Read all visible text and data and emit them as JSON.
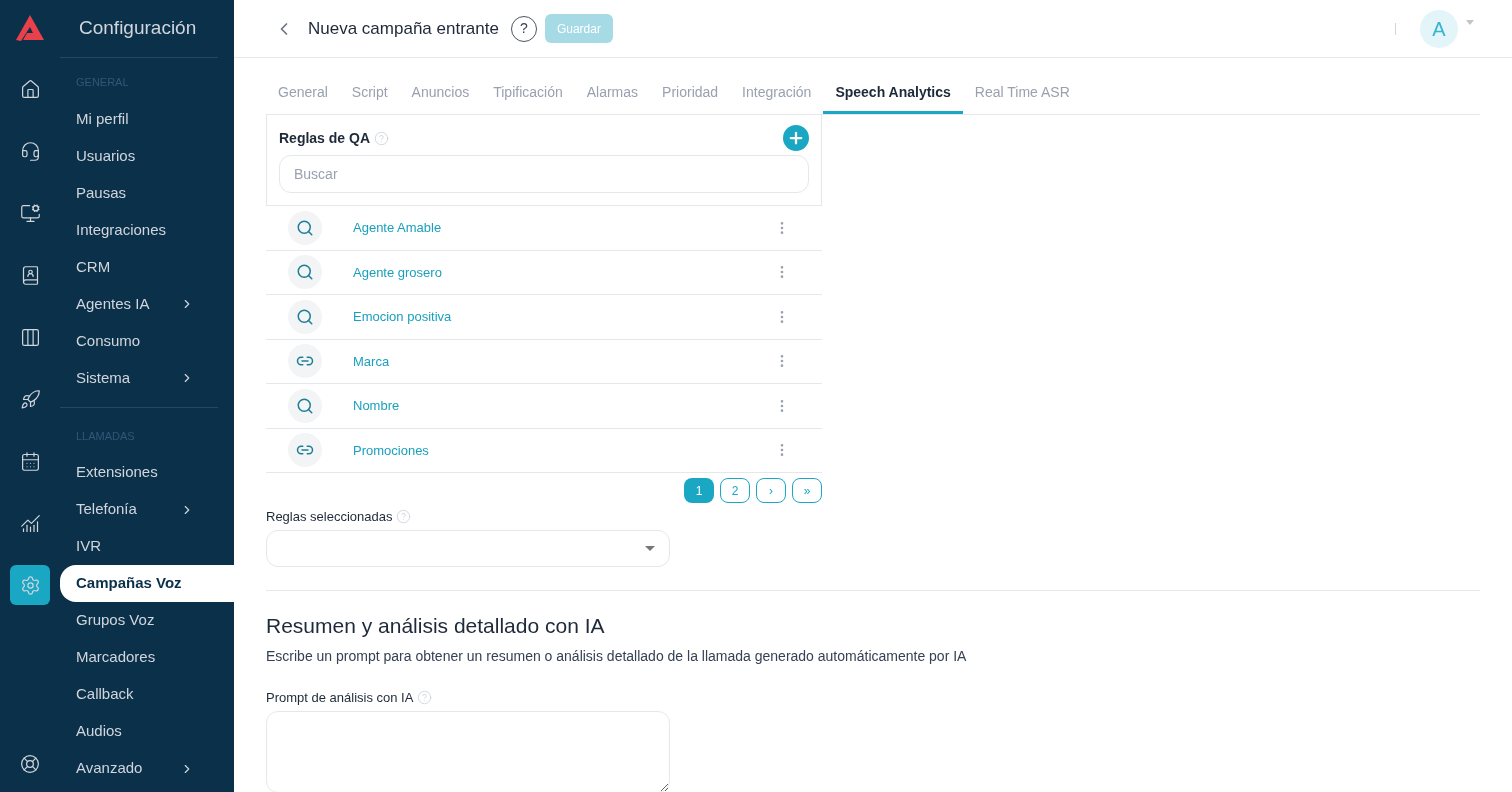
{
  "rail": [
    {
      "kind": "home",
      "selected": false
    },
    {
      "kind": "headset",
      "selected": false
    },
    {
      "kind": "monitor",
      "selected": false
    },
    {
      "kind": "contacts",
      "selected": false
    },
    {
      "kind": "board",
      "selected": false
    },
    {
      "kind": "rocket",
      "selected": false
    },
    {
      "kind": "calendar",
      "selected": false
    },
    {
      "kind": "chart",
      "selected": false
    },
    {
      "kind": "settings",
      "selected": true
    }
  ],
  "rail_bottom": {
    "kind": "help"
  },
  "sidebar": {
    "title": "Configuración",
    "sections": [
      {
        "header": "GENERAL",
        "items": [
          {
            "label": "Mi perfil",
            "submenu": false,
            "selected": false
          },
          {
            "label": "Usuarios",
            "submenu": false,
            "selected": false
          },
          {
            "label": "Pausas",
            "submenu": false,
            "selected": false
          },
          {
            "label": "Integraciones",
            "submenu": false,
            "selected": false
          },
          {
            "label": "CRM",
            "submenu": false,
            "selected": false
          },
          {
            "label": "Agentes IA",
            "submenu": true,
            "selected": false
          },
          {
            "label": "Consumo",
            "submenu": false,
            "selected": false
          },
          {
            "label": "Sistema",
            "submenu": true,
            "selected": false
          }
        ]
      },
      {
        "header": "LLAMADAS",
        "items": [
          {
            "label": "Extensiones",
            "submenu": false,
            "selected": false
          },
          {
            "label": "Telefonía",
            "submenu": true,
            "selected": false
          },
          {
            "label": "IVR",
            "submenu": false,
            "selected": false
          },
          {
            "label": "Campañas Voz",
            "submenu": false,
            "selected": true
          },
          {
            "label": "Grupos Voz",
            "submenu": false,
            "selected": false
          },
          {
            "label": "Marcadores",
            "submenu": false,
            "selected": false
          },
          {
            "label": "Callback",
            "submenu": false,
            "selected": false
          },
          {
            "label": "Audios",
            "submenu": false,
            "selected": false
          },
          {
            "label": "Avanzado",
            "submenu": true,
            "selected": false
          }
        ]
      }
    ]
  },
  "header": {
    "title": "Nueva campaña entrante",
    "help": "?",
    "save_button": {
      "label": "Guardar",
      "disabled": true
    },
    "avatar": "A"
  },
  "tabs": [
    {
      "label": "General",
      "selected": false
    },
    {
      "label": "Script",
      "selected": false
    },
    {
      "label": "Anuncios",
      "selected": false
    },
    {
      "label": "Tipificación",
      "selected": false
    },
    {
      "label": "Alarmas",
      "selected": false
    },
    {
      "label": "Prioridad",
      "selected": false
    },
    {
      "label": "Integración",
      "selected": false
    },
    {
      "label": "Speech Analytics",
      "selected": true
    },
    {
      "label": "Real Time ASR",
      "selected": false
    }
  ],
  "qa_rules": {
    "title": "Reglas de QA",
    "search": {
      "placeholder": "Buscar"
    },
    "rules": [
      {
        "name": "Agente Amable",
        "kind": "search"
      },
      {
        "name": "Agente grosero",
        "kind": "search"
      },
      {
        "name": "Emocion positiva",
        "kind": "search"
      },
      {
        "name": "Marca",
        "kind": "link"
      },
      {
        "name": "Nombre",
        "kind": "search"
      },
      {
        "name": "Promociones",
        "kind": "link"
      }
    ],
    "pagination": [
      {
        "label": "1",
        "selected": true
      },
      {
        "label": "2",
        "selected": false
      },
      {
        "label": "›",
        "selected": false
      },
      {
        "label": "»",
        "selected": false
      }
    ]
  },
  "selected_rules": {
    "label": "Reglas seleccionadas"
  },
  "ai_summary": {
    "title": "Resumen y análisis detallado con IA",
    "description": "Escribe un prompt para obtener un resumen o análisis detallado de la llamada generado automáticamente por IA",
    "prompt_label": "Prompt de análisis con IA"
  }
}
